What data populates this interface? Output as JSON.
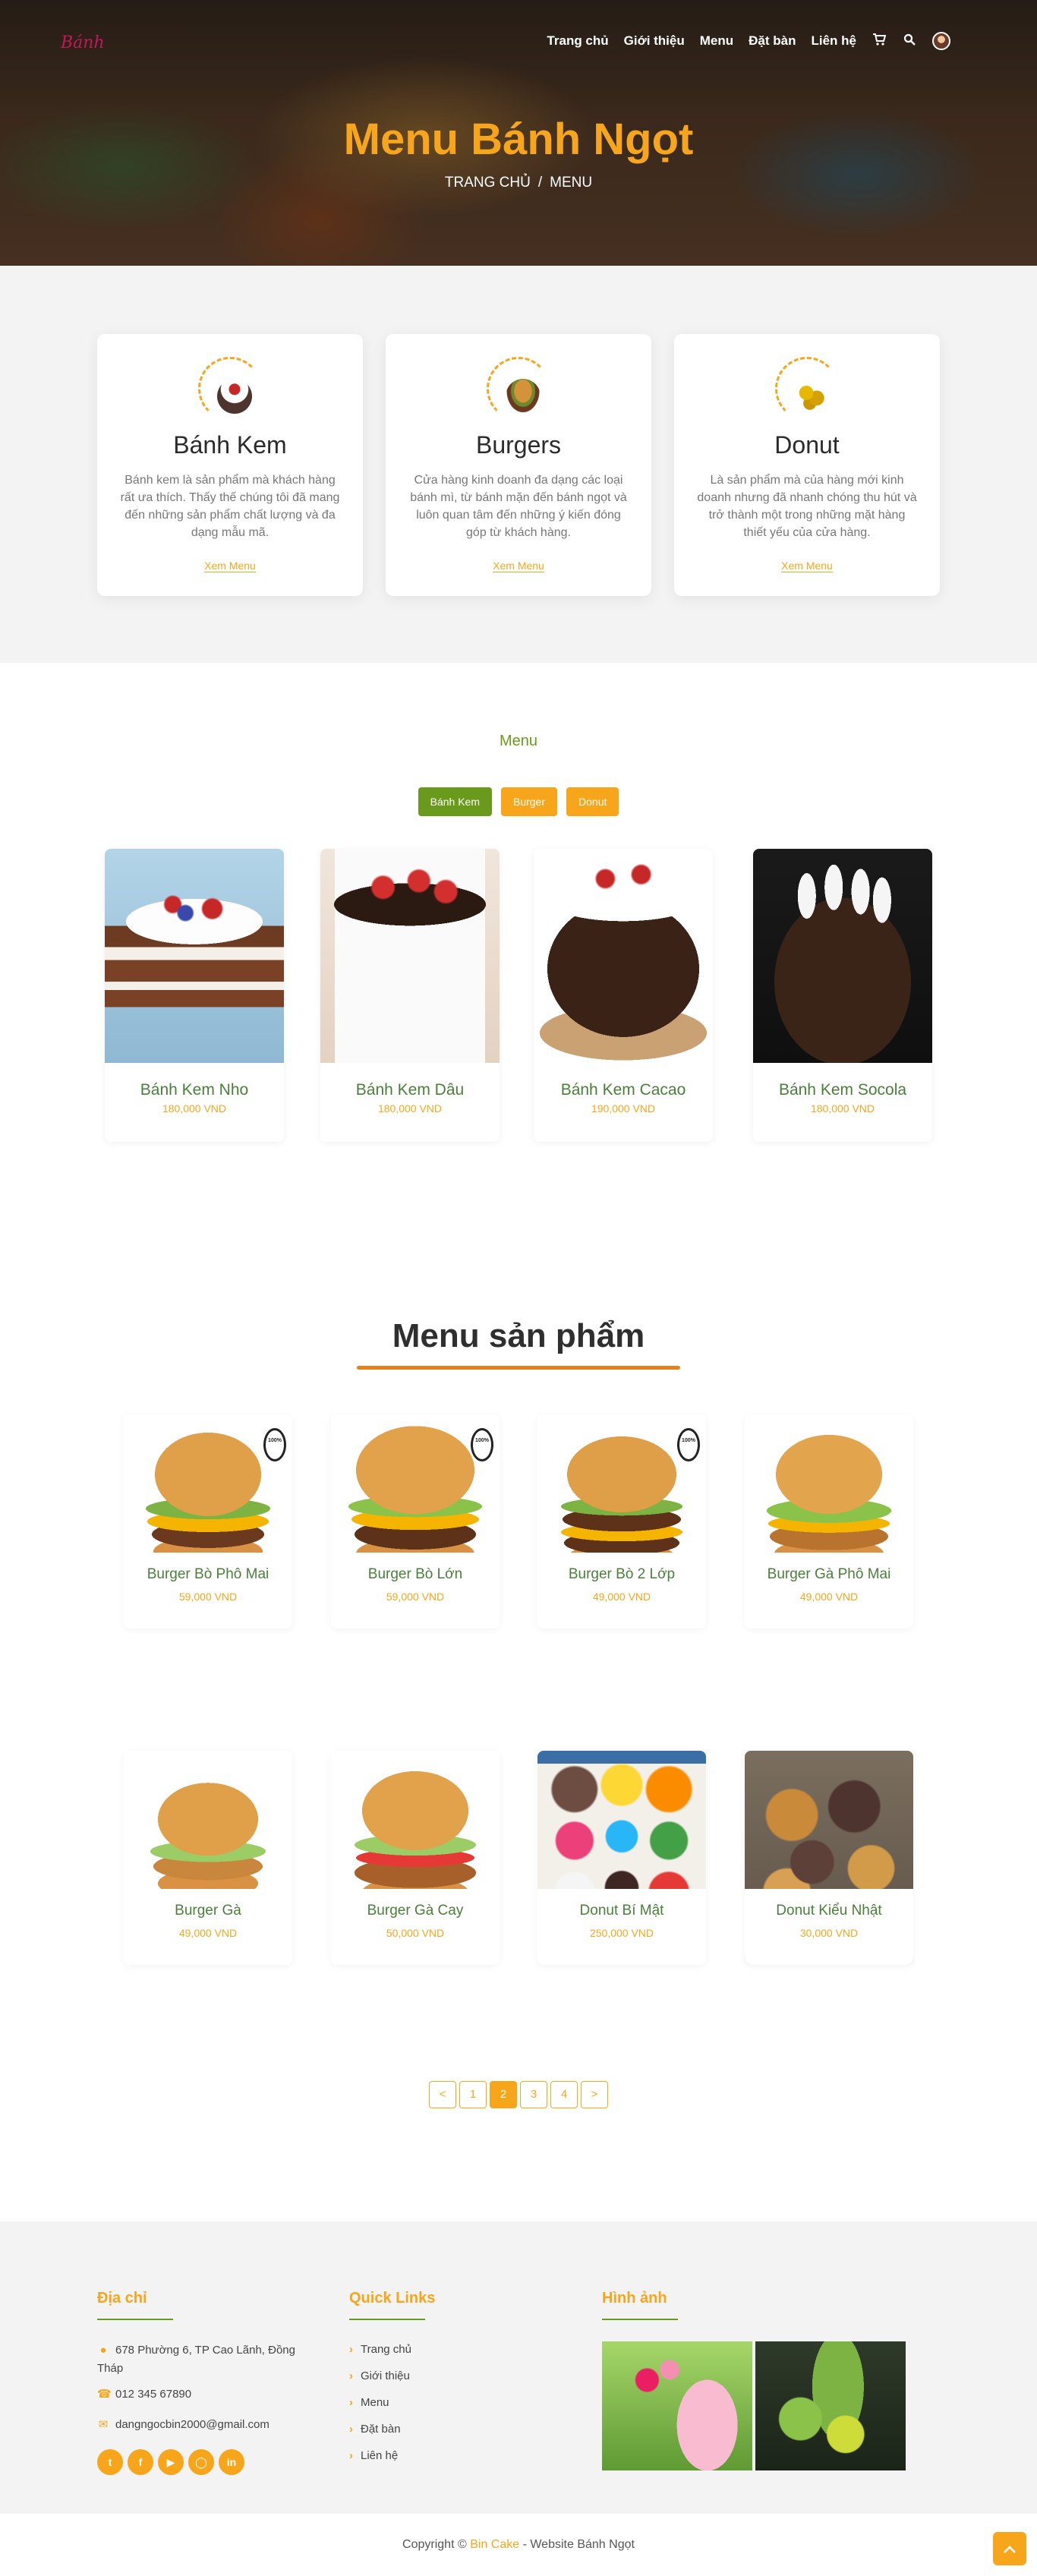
{
  "brand": {
    "logo_text": "Bánh",
    "accent": "#f7a61c",
    "green": "#6a9a1c"
  },
  "nav": {
    "links": [
      "Trang chủ",
      "Giới thiệu",
      "Menu",
      "Đặt bàn",
      "Liên hệ"
    ],
    "icons": [
      "cart-icon",
      "search-icon",
      "avatar"
    ]
  },
  "hero": {
    "title": "Menu Bánh Ngọt",
    "breadcrumb": {
      "home": "TRANG CHỦ",
      "separator": "/",
      "current": "MENU"
    }
  },
  "services": [
    {
      "title": "Bánh Kem",
      "desc": "Bánh kem là sản phẩm mà khách hàng rất ưa thích. Thấy thế chúng tôi đã mang đến những sản phẩm chất lượng và đa dạng mẫu mã.",
      "link": "Xem Menu"
    },
    {
      "title": "Burgers",
      "desc": "Cửa hàng kinh doanh đa dạng các loại bánh mì, từ bánh mặn đến bánh ngọt và luôn quan tâm đến những ý kiến đóng góp từ khách hàng.",
      "link": "Xem Menu"
    },
    {
      "title": "Donut",
      "desc": "Là sản phẩm mà của hàng mới kinh doanh nhưng đã nhanh chóng thu hút và trở thành một trong những mặt hàng thiết yếu của cửa hàng.",
      "link": "Xem Menu"
    }
  ],
  "menu": {
    "label": "Menu",
    "filters": [
      {
        "label": "Bánh Kem",
        "active": true
      },
      {
        "label": "Burger",
        "active": false
      },
      {
        "label": "Donut",
        "active": false
      }
    ],
    "items": [
      {
        "name": "Bánh Kem Nho",
        "price": "180,000 VND"
      },
      {
        "name": "Bánh Kem Dâu",
        "price": "180,000 VND"
      },
      {
        "name": "Bánh Kem Cacao",
        "price": "190,000 VND"
      },
      {
        "name": "Bánh Kem Socola",
        "price": "180,000 VND"
      }
    ]
  },
  "products": {
    "title": "Menu sản phẩm",
    "items": [
      {
        "name": "Burger Bò Phô Mai",
        "price": "59,000 VND"
      },
      {
        "name": "Burger Bò Lớn",
        "price": "59,000 VND"
      },
      {
        "name": "Burger Bò 2 Lớp",
        "price": "49,000 VND"
      },
      {
        "name": "Burger Gà Phô Mai",
        "price": "49,000 VND"
      },
      {
        "name": "Burger Gà",
        "price": "49,000 VND"
      },
      {
        "name": "Burger Gà Cay",
        "price": "50,000 VND"
      },
      {
        "name": "Donut Bí Mật",
        "price": "250,000 VND"
      },
      {
        "name": "Donut Kiểu Nhật",
        "price": "30,000 VND"
      }
    ],
    "pagination": [
      "<",
      "1",
      "2",
      "3",
      "4",
      ">"
    ],
    "current_page": "2"
  },
  "footer": {
    "address_title": "Địa chỉ",
    "address": "678 Phường 6, TP Cao Lãnh, Đồng Tháp",
    "phone": "012 345 67890",
    "email": "dangngocbin2000@gmail.com",
    "socials": [
      "twitter-icon",
      "facebook-icon",
      "youtube-icon",
      "instagram-icon",
      "linkedin-icon"
    ],
    "links_title": "Quick Links",
    "links": [
      "Trang chủ",
      "Giới thiệu",
      "Menu",
      "Đặt bàn",
      "Liên hệ"
    ],
    "gallery_title": "Hình ảnh"
  },
  "copyright": {
    "prefix": "Copyright ©",
    "brand": "Bin Cake",
    "suffix": "- Website Bánh Ngọt"
  }
}
